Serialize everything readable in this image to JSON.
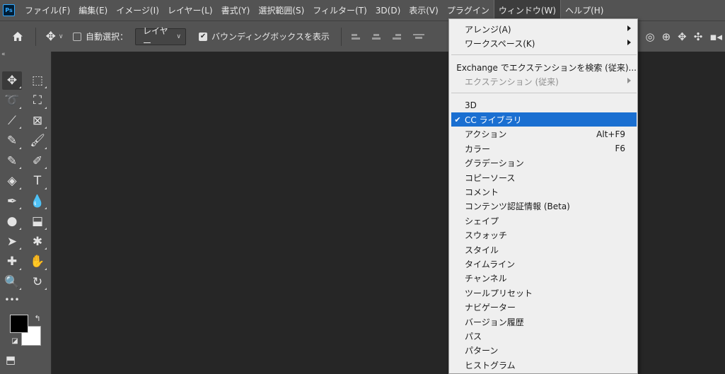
{
  "app": {
    "logo": "Ps"
  },
  "menubar": {
    "items": [
      {
        "label": "ファイル(F)"
      },
      {
        "label": "編集(E)"
      },
      {
        "label": "イメージ(I)"
      },
      {
        "label": "レイヤー(L)"
      },
      {
        "label": "書式(Y)"
      },
      {
        "label": "選択範囲(S)"
      },
      {
        "label": "フィルター(T)"
      },
      {
        "label": "3D(D)"
      },
      {
        "label": "表示(V)"
      },
      {
        "label": "プラグイン"
      },
      {
        "label": "ウィンドウ(W)",
        "active": true
      },
      {
        "label": "ヘルプ(H)"
      }
    ]
  },
  "options_bar": {
    "auto_select_label": "自動選択：",
    "auto_select_checked": false,
    "layer_dropdown_value": "レイヤー",
    "show_bounding_box_label": "バウンディングボックスを表示",
    "show_bounding_box_checked": true
  },
  "window_menu": {
    "groups": [
      [
        {
          "label": "アレンジ(A)",
          "submenu": true
        },
        {
          "label": "ワークスペース(K)",
          "submenu": true
        }
      ],
      [
        {
          "label": "Exchange でエクステンションを検索 (従来)..."
        },
        {
          "label": "エクステンション (従来)",
          "submenu": true,
          "disabled": true
        }
      ],
      [
        {
          "label": "3D"
        },
        {
          "label": "CC ライブラリ",
          "checked": true,
          "highlighted": true
        },
        {
          "label": "アクション",
          "shortcut": "Alt+F9"
        },
        {
          "label": "カラー",
          "shortcut": "F6"
        },
        {
          "label": "グラデーション"
        },
        {
          "label": "コピーソース"
        },
        {
          "label": "コメント"
        },
        {
          "label": "コンテンツ認証情報 (Beta)"
        },
        {
          "label": "シェイプ"
        },
        {
          "label": "スウォッチ"
        },
        {
          "label": "スタイル"
        },
        {
          "label": "タイムライン"
        },
        {
          "label": "チャンネル"
        },
        {
          "label": "ツールプリセット"
        },
        {
          "label": "ナビゲーター"
        },
        {
          "label": "バージョン履歴"
        },
        {
          "label": "パス"
        },
        {
          "label": "パターン"
        },
        {
          "label": "ヒストグラム"
        }
      ]
    ],
    "check_glyph": "✔"
  },
  "toolbar": {
    "tools": [
      {
        "name": "move-tool-icon",
        "glyph": "✥",
        "selected": true
      },
      {
        "name": "rectangular-marquee-tool-icon",
        "glyph": "⬚"
      },
      {
        "name": "lasso-tool-icon",
        "glyph": "➰"
      },
      {
        "name": "object-selection-tool-icon",
        "glyph": "⛶"
      },
      {
        "name": "crop-tool-icon",
        "glyph": "⟋"
      },
      {
        "name": "frame-tool-icon",
        "glyph": "⊠"
      },
      {
        "name": "eyedropper-tool-icon",
        "glyph": "✎"
      },
      {
        "name": "brush-tool-icon",
        "glyph": "🖌"
      },
      {
        "name": "healing-brush-tool-icon",
        "glyph": "✎"
      },
      {
        "name": "clone-stamp-tool-icon",
        "glyph": "✐"
      },
      {
        "name": "paint-bucket-tool-icon",
        "glyph": "◈"
      },
      {
        "name": "type-tool-icon",
        "glyph": "T"
      },
      {
        "name": "pen-tool-icon",
        "glyph": "✒"
      },
      {
        "name": "blur-tool-icon",
        "glyph": "💧"
      },
      {
        "name": "dodge-tool-icon",
        "glyph": "●"
      },
      {
        "name": "stamp-tool-icon",
        "glyph": "⬓"
      },
      {
        "name": "path-selection-tool-icon",
        "glyph": "➤"
      },
      {
        "name": "custom-shape-tool-icon",
        "glyph": "✱"
      },
      {
        "name": "bandage-tool-icon",
        "glyph": "✚"
      },
      {
        "name": "hand-tool-icon",
        "glyph": "✋"
      },
      {
        "name": "zoom-tool-icon",
        "glyph": "🔍"
      },
      {
        "name": "rotate-view-tool-icon",
        "glyph": "↻"
      },
      {
        "name": "more-tools-icon",
        "glyph": "•••"
      },
      {
        "name": "swap-colors-icon",
        "glyph": "↰"
      },
      {
        "name": "default-colors-icon",
        "glyph": "◪"
      },
      {
        "name": "quick-mask-icon",
        "glyph": "⬒"
      }
    ],
    "foreground_color": "#000000",
    "background_color": "#ffffff"
  },
  "colors": {
    "chrome": "#535353",
    "canvas": "#262626",
    "menu_bg": "#efefef",
    "menu_highlight": "#1a6fd1"
  }
}
